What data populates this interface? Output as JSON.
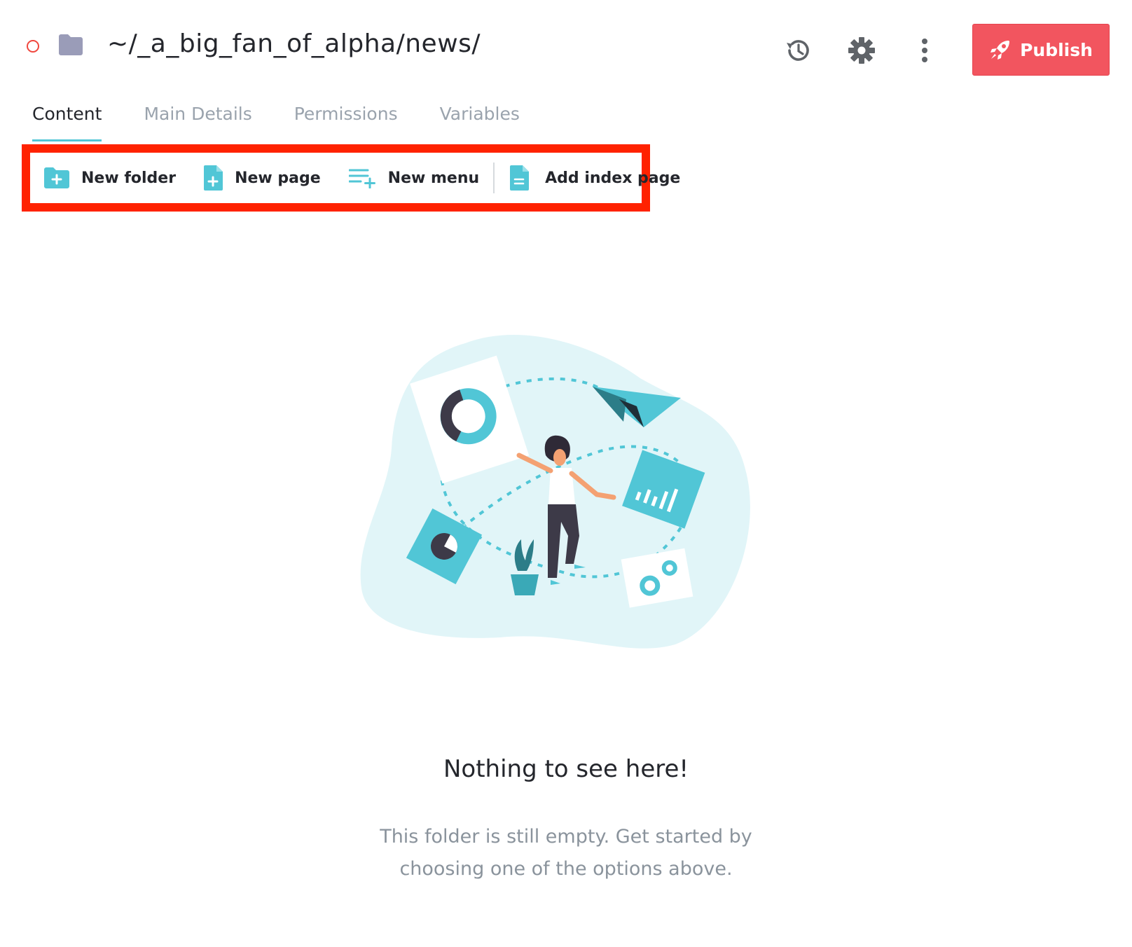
{
  "header": {
    "path": "~/_a_big_fan_of_alpha/news/",
    "status_icon": "circle-outline-icon",
    "folder_icon": "folder-icon",
    "history_icon": "history-icon",
    "settings_icon": "gear-icon",
    "more_icon": "more-vertical-icon",
    "publish_label": "Publish",
    "publish_icon": "rocket-icon",
    "publish_color": "#f2555f"
  },
  "tabs": [
    {
      "label": "Content",
      "active": true
    },
    {
      "label": "Main Details",
      "active": false
    },
    {
      "label": "Permissions",
      "active": false
    },
    {
      "label": "Variables",
      "active": false
    }
  ],
  "toolbar": {
    "new_folder": "New folder",
    "new_page": "New page",
    "new_menu": "New menu",
    "add_index_page": "Add index page",
    "icon_color": "#51c6d6",
    "highlight_color": "#ff2200"
  },
  "empty_state": {
    "title": "Nothing to see here!",
    "description": "This folder is still empty. Get started by choosing one of the options above."
  }
}
